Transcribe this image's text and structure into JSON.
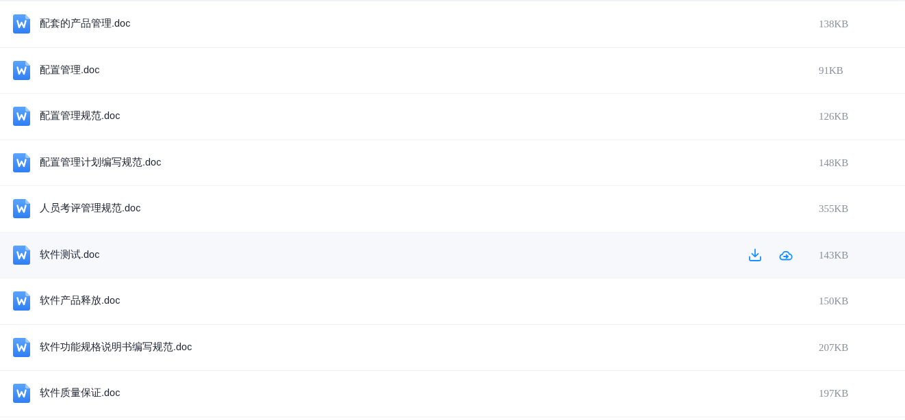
{
  "files": [
    {
      "name": "配套的产品管理.doc",
      "size": "138KB",
      "hovered": false
    },
    {
      "name": "配置管理.doc",
      "size": "91KB",
      "hovered": false
    },
    {
      "name": "配置管理规范.doc",
      "size": "126KB",
      "hovered": false
    },
    {
      "name": "配置管理计划编写规范.doc",
      "size": "148KB",
      "hovered": false
    },
    {
      "name": "人员考评管理规范.doc",
      "size": "355KB",
      "hovered": false
    },
    {
      "name": "软件测试.doc",
      "size": "143KB",
      "hovered": true
    },
    {
      "name": "软件产品释放.doc",
      "size": "150KB",
      "hovered": false
    },
    {
      "name": "软件功能规格说明书编写规范.doc",
      "size": "207KB",
      "hovered": false
    },
    {
      "name": "软件质量保证.doc",
      "size": "197KB",
      "hovered": false
    }
  ]
}
